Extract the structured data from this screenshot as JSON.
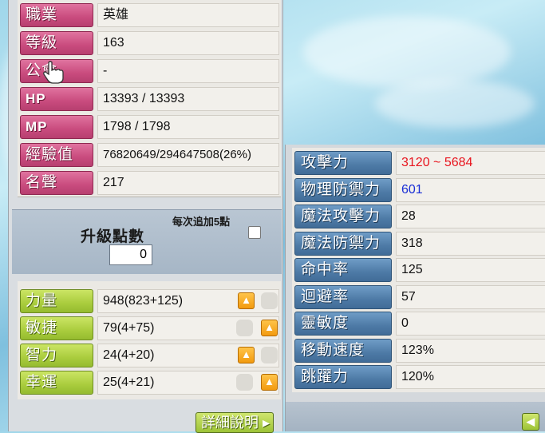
{
  "character": {
    "rows": [
      {
        "label": "職業",
        "value": "英雄"
      },
      {
        "label": "等級",
        "value": "163"
      },
      {
        "label": "公會",
        "value": "-"
      },
      {
        "label": "HP",
        "value": "13393 / 13393"
      },
      {
        "label": "MP",
        "value": "1798 / 1798"
      },
      {
        "label": "經驗值",
        "value": "76820649/294647508(26%)"
      },
      {
        "label": "名聲",
        "value": "217"
      }
    ]
  },
  "ability_points": {
    "label": "升級點數",
    "value": "0",
    "auto_label": "每次追加5點",
    "auto_checked": false
  },
  "stats": [
    {
      "label": "力量",
      "value": "948(823+125)"
    },
    {
      "label": "敏捷",
      "value": "79(4+75)"
    },
    {
      "label": "智力",
      "value": "24(4+20)"
    },
    {
      "label": "幸運",
      "value": "25(4+21)"
    }
  ],
  "detail_button": "詳細說明",
  "detail_stats": [
    {
      "label": "攻擊力",
      "value": "3120 ~ 5684",
      "color": "#e8141e"
    },
    {
      "label": "物理防禦力",
      "value": "601",
      "color": "#1a2fd6"
    },
    {
      "label": "魔法攻擊力",
      "value": "28",
      "color": "#111111"
    },
    {
      "label": "魔法防禦力",
      "value": "318",
      "color": "#111111"
    },
    {
      "label": "命中率",
      "value": "125",
      "color": "#111111"
    },
    {
      "label": "迴避率",
      "value": "57",
      "color": "#111111"
    },
    {
      "label": "靈敏度",
      "value": "0",
      "color": "#111111"
    },
    {
      "label": "移動速度",
      "value": "123%",
      "color": "#111111"
    },
    {
      "label": "跳躍力",
      "value": "120%",
      "color": "#111111"
    }
  ],
  "icons": {
    "cursor": "hand-cursor-icon",
    "add_point": "arrow-up-icon",
    "back": "arrow-left-icon"
  }
}
